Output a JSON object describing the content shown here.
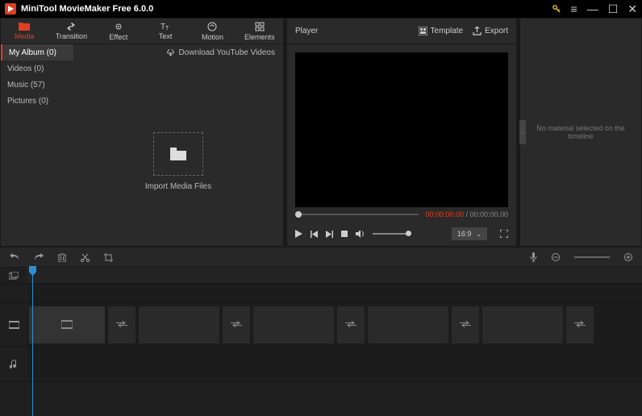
{
  "app": {
    "title": "MiniTool MovieMaker Free 6.0.0"
  },
  "tabs": [
    {
      "label": "Media",
      "icon": "folder-icon"
    },
    {
      "label": "Transition",
      "icon": "swap-icon"
    },
    {
      "label": "Effect",
      "icon": "sparkle-icon"
    },
    {
      "label": "Text",
      "icon": "text-icon"
    },
    {
      "label": "Motion",
      "icon": "motion-icon"
    },
    {
      "label": "Elements",
      "icon": "elements-icon"
    }
  ],
  "library": {
    "download_label": "Download YouTube Videos",
    "items": [
      {
        "label": "My Album (0)"
      },
      {
        "label": "Videos (0)"
      },
      {
        "label": "Music (57)"
      },
      {
        "label": "Pictures (0)"
      }
    ],
    "import_label": "Import Media Files"
  },
  "player": {
    "title": "Player",
    "template_label": "Template",
    "export_label": "Export",
    "time_current": "00:00:00.00",
    "time_sep": " / ",
    "time_total": "00:00:00.00",
    "aspect": "16:9"
  },
  "inspector": {
    "empty_text": "No material selected on the timeline"
  }
}
